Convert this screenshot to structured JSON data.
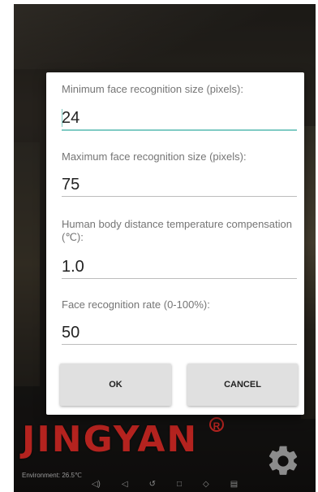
{
  "dialog": {
    "fields": [
      {
        "label": "Minimum face recognition size (pixels):",
        "value": "24"
      },
      {
        "label": "Maximum face recognition size (pixels):",
        "value": "75"
      },
      {
        "label": "Human body distance temperature compensation (℃):",
        "value": "1.0"
      },
      {
        "label": "Face recognition rate (0-100%):",
        "value": "50"
      }
    ],
    "ok_label": "OK",
    "cancel_label": "CANCEL"
  },
  "brand": {
    "name": "JINGYAN",
    "reg_mark": "R",
    "color": "#b4231f"
  },
  "status": {
    "environment": "Environment: 26.5℃"
  },
  "icons": [
    "gear-icon",
    "volume-down-icon",
    "back-icon",
    "screenshot-icon",
    "home-icon",
    "recents-icon",
    "volume-up-icon",
    "menu-icon"
  ],
  "colors": {
    "accent": "#80cbc4",
    "button": "#e0e0e0"
  }
}
